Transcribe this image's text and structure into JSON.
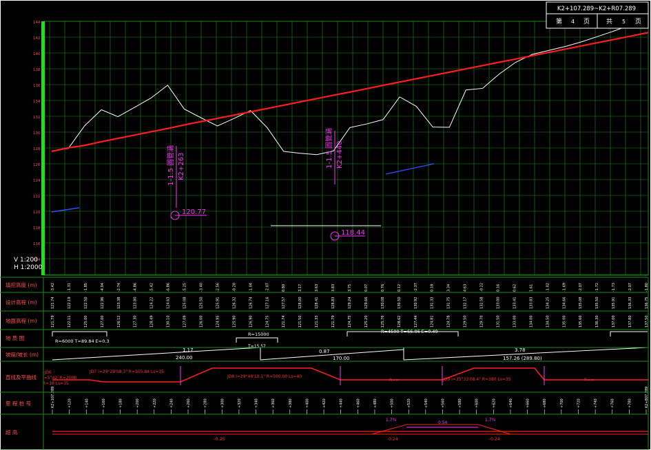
{
  "title_block": {
    "range": "K2+107.289~K2+R07.289",
    "sheet_prefix": "第",
    "sheet_no": "4",
    "sheet_unit": "页",
    "total_prefix": "共",
    "total_no": "5",
    "total_unit": "页"
  },
  "scale": {
    "vertical": "V 1:200",
    "horizontal": "H 1:2000"
  },
  "elevation_axis": [
    "144",
    "142",
    "140",
    "138",
    "136",
    "134",
    "132",
    "130",
    "128",
    "126",
    "124",
    "122",
    "120",
    "118",
    "116",
    "114"
  ],
  "culverts": [
    {
      "spec": "1-1.5 圆管涵",
      "station": "K2+263"
    },
    {
      "spec": "1-1.5 圆管涵",
      "station": "K2+440"
    }
  ],
  "control_points": [
    "120.77",
    "118.44"
  ],
  "row_labels": [
    "填挖高度 (m)",
    "设计高程 (m)",
    "地面高程 (m)",
    "地 质 图",
    "坡度/坡长 (m)",
    "直线及平曲线",
    "里 程 桩 号",
    "超 高"
  ],
  "fill_cut": [
    "-3.42",
    "-1.31",
    "-1.85",
    "-4.04",
    "-2.74",
    "-4.86",
    "-5.42",
    "-6.86",
    "-5.25",
    "-3.40",
    "-2.56",
    "-0.20",
    "-1.04",
    "-2.07",
    "0.80",
    "3.17",
    "3.63",
    "3.83",
    "3.75",
    "0.07",
    "0.76",
    "0.12",
    "-2.37",
    "0.18",
    "3.34",
    "4.63",
    "-0.22",
    "0.16",
    "0.62",
    "1.61",
    "-1.02",
    "-1.69",
    "-2.07",
    "-1.72",
    "-1.73",
    "-2.07",
    "-1.80"
  ],
  "design_elev": [
    "121.74",
    "122.19",
    "122.50",
    "122.96",
    "123.38",
    "123.80",
    "124.22",
    "124.63",
    "125.08",
    "125.50",
    "125.91",
    "126.32",
    "126.74",
    "127.16",
    "127.57",
    "128.00",
    "128.41",
    "128.83",
    "129.24",
    "129.66",
    "130.08",
    "130.50",
    "130.92",
    "131.33",
    "131.75",
    "132.17",
    "132.58",
    "133.00",
    "133.41",
    "133.83",
    "134.25",
    "134.66",
    "135.08",
    "135.50",
    "135.91",
    "136.33",
    "136.75"
  ],
  "ground_elev": [
    "121.79",
    "122.11",
    "125.00",
    "127.00",
    "126.12",
    "127.30",
    "128.49",
    "130.10",
    "127.09",
    "126.00",
    "124.95",
    "125.90",
    "126.90",
    "124.75",
    "121.74",
    "121.50",
    "121.33",
    "121.79",
    "124.75",
    "125.20",
    "125.76",
    "128.62",
    "127.44",
    "124.81",
    "124.78",
    "129.50",
    "129.70",
    "131.50",
    "133.00",
    "134.00",
    "134.50",
    "135.00",
    "135.60",
    "136.30",
    "137.00",
    "137.80",
    "137.50"
  ],
  "geology": {
    "left": "R=6000 T=89.84 E=0.3",
    "mid": "R=15000",
    "mid2": "T=15.57",
    "right": "R=4500 T=66.06 E=0.49"
  },
  "grades": [
    {
      "grade": "1.17",
      "length": "240.00"
    },
    {
      "grade": "0.87",
      "length": "170.00"
    },
    {
      "grade": "3.78",
      "length": "157.26 (289.80)"
    }
  ],
  "curves": [
    {
      "text": "JD7 I=29°29'58.3\" R=505.84 Ls=35"
    },
    {
      "text": "JD8 I=29°49'10.1\" R=500.00 Ls=40"
    },
    {
      "text": "R=∞"
    },
    {
      "text": "JD9 I=35°33'08.4\" R=380 Ls=35"
    },
    {
      "text": "R=∞"
    }
  ],
  "curve_left": [
    "-JD6",
    "I=5°42' R=2000",
    "R=18 Ls=35"
  ],
  "stations": [
    "K2+107.289",
    "+120",
    "+140",
    "+160",
    "+180",
    "+200",
    "+220",
    "+240",
    "+260",
    "+280",
    "+300",
    "+320",
    "+340",
    "+360",
    "+380",
    "+400",
    "+420",
    "+440",
    "+460",
    "+480",
    "+500",
    "+520",
    "+540",
    "+560",
    "+580",
    "+600",
    "+620",
    "+640",
    "+660",
    "+680",
    "+700",
    "+720",
    "+740",
    "+760",
    "+780",
    "K2+807.289"
  ],
  "superelev": {
    "main": "-0.25",
    "left": "-0.24",
    "mid": "-0.24",
    "top1": "1.7%",
    "top2": "0.54",
    "top3": "1.7%"
  },
  "colors": {
    "grid": "#1f8c1f",
    "design": "#ff1e1e",
    "ground": "#ffffff",
    "annot": "#ff33ff",
    "text": "#ff5a5a"
  }
}
